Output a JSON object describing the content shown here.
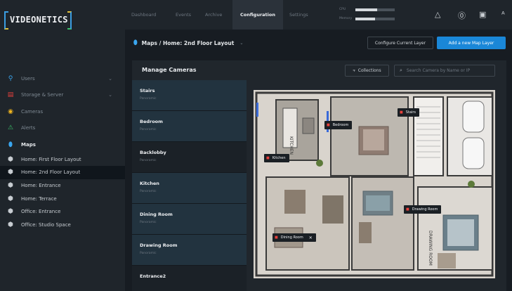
{
  "brand": {
    "name": "VIDEONETICS"
  },
  "nav": {
    "sections": [
      {
        "label": "Users",
        "icon": "user-icon",
        "glyph": "⚲",
        "color": "#3aa6f0",
        "chevron": true
      },
      {
        "label": "Storage & Server",
        "icon": "server-icon",
        "glyph": "▤",
        "color": "#e8413c",
        "chevron": true
      },
      {
        "label": "Cameras",
        "icon": "camera-icon",
        "glyph": "◉",
        "color": "#f2b61f",
        "chevron": false
      },
      {
        "label": "Alerts",
        "icon": "bell-icon",
        "glyph": "⚠",
        "color": "#3bc26a",
        "chevron": false
      }
    ],
    "maps_label": "Maps",
    "map_layouts": [
      "Home: First Floor Layout",
      "Home: 2nd Floor Layout",
      "Home: Entrance",
      "Home: Terrace",
      "Office: Entrance",
      "Office: Studio Space"
    ],
    "active_layout_index": 1
  },
  "topnav": {
    "tabs": [
      "Dashboard",
      "Events",
      "Archive",
      "Configuration",
      "Settings"
    ],
    "active_tab": "Configuration",
    "cpu_label": "CPU",
    "memory_label": "Memory",
    "cpu_usage": 0.55,
    "memory_usage": 0.5
  },
  "breadcrumb": {
    "text": "Maps / Home: 2nd Floor Layout"
  },
  "actions": {
    "configure_layer": "Configure Current Layer",
    "add_layer": "Add a new Map Layer"
  },
  "panel": {
    "title": "Manage Cameras",
    "collections_label": "Collections",
    "search_placeholder": "Search Camera by Name or IP"
  },
  "cameras": [
    {
      "name": "Stairs",
      "status": "Panoramic"
    },
    {
      "name": "Bedroom",
      "status": "Panoramic"
    },
    {
      "name": "Backlobby",
      "status": "Panoramic"
    },
    {
      "name": "Kitchen",
      "status": "Panoramic"
    },
    {
      "name": "Dining Room",
      "status": "Panoramic"
    },
    {
      "name": "Drawing Room",
      "status": "Panoramic"
    },
    {
      "name": "Entrance2",
      "status": ""
    }
  ],
  "map_tags": [
    "Stairs",
    "Bedroom",
    "Kitchen",
    "Drawing Room",
    "Dining Room"
  ],
  "map_room_labels": [
    "KITCHEN",
    "DRAWING ROOM"
  ],
  "colors": {
    "accent": "#1a87d8",
    "camera_marker": "#e8413c",
    "sidebar_bg": "#1f252b",
    "content_bg": "#171c22"
  }
}
